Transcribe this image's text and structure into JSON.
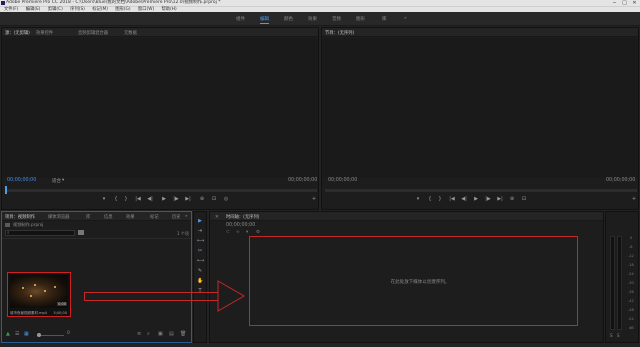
{
  "window": {
    "title": "Adobe Premiere Pro CC 2018 - C:\\Users\\Blue\\我的文档\\Adobe\\Premiere Pro\\12.0\\视频制作.prproj *",
    "minimize": "─",
    "maximize": "□",
    "close": "✕"
  },
  "menu": [
    "文件(F)",
    "编辑(E)",
    "剪辑(C)",
    "序列(S)",
    "标记(M)",
    "图形(G)",
    "窗口(W)",
    "帮助(H)"
  ],
  "workspaces": {
    "items": [
      "组件",
      "编辑",
      "颜色",
      "效果",
      "音频",
      "图形",
      "库"
    ],
    "active_index": 1,
    "more": "»"
  },
  "source_panel": {
    "tabs": [
      "源：(无剪辑)",
      "效果控件",
      "音频剪辑混合器",
      "元数据"
    ],
    "active_index": 0,
    "timecode_left": "00;00;00;00",
    "fit": "适合",
    "fit_arrow": "▾",
    "timecode_right": "00;00;00;00",
    "controls": [
      "▾",
      "{",
      "}",
      "|◀",
      "◀|",
      "▶",
      "|▶",
      "▶|",
      "⊕",
      "⊡",
      "◎"
    ],
    "add": "+"
  },
  "program_panel": {
    "tab": "节目：(无序列)",
    "timecode_left": "00;00;00;00",
    "timecode_right": "00;00;00;00",
    "controls": [
      "▾",
      "{",
      "}",
      "|◀",
      "◀|",
      "▶",
      "|▶",
      "▶|",
      "⊕",
      "⊡"
    ],
    "add": "+"
  },
  "project_panel": {
    "tabs": [
      "项目：视频制作",
      "媒体浏览器",
      "库",
      "信息",
      "效果",
      "标记",
      "历史"
    ],
    "more": "»",
    "project_file": "视频制作.prproj",
    "item_count": "1 个项",
    "clip": {
      "name": "城市夜景视频素材.mp4",
      "duration_badge": "0;00",
      "duration": "5;00;00"
    },
    "bottom": {
      "list_view": "☰",
      "icon_view": "▦",
      "zoom_value": "0",
      "search": "⌕",
      "new_bin": "▣",
      "new_item": "▤",
      "delete": "🗑"
    }
  },
  "tools": [
    "▶",
    "⇥",
    "⟷",
    "✂",
    "⟷",
    "✎",
    "✋",
    "T"
  ],
  "timeline_panel": {
    "tab": "时间轴：(无序列)",
    "timecode": "00;00;00;00",
    "empty_message": "在此处放下媒体以创建序列。"
  },
  "audio_meter": {
    "scale": [
      "0",
      "-6",
      "-12",
      "-18",
      "-24",
      "-30",
      "-36",
      "-42",
      "-48",
      "-54",
      "dB"
    ],
    "solo_left": "S",
    "solo_right": "S"
  },
  "colors": {
    "accent": "#4f9be8",
    "annotation_red": "#c62828",
    "panel_bg": "#1d1d1d",
    "chrome_bg": "#e4e4e4"
  }
}
